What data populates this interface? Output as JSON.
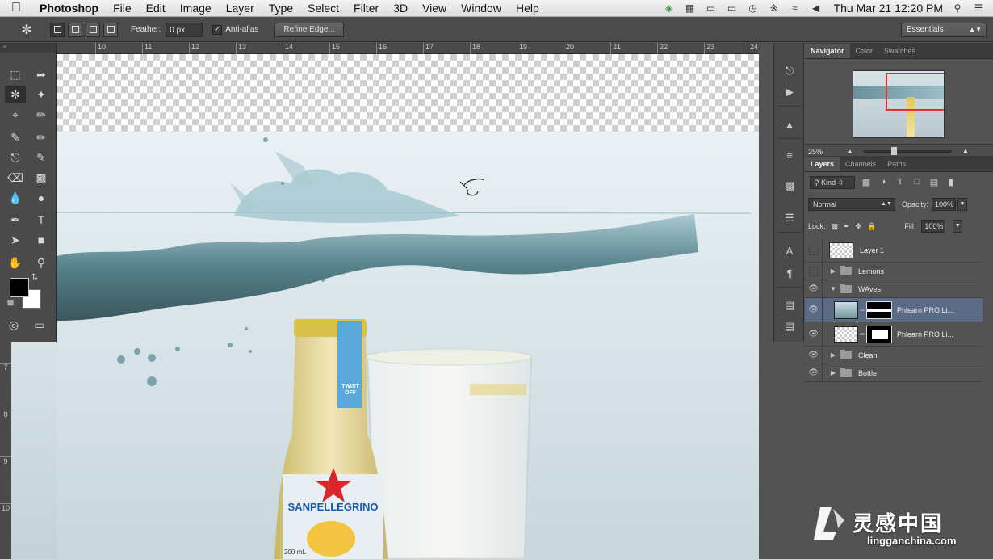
{
  "menubar": {
    "app_name": "Photoshop",
    "items": [
      "File",
      "Edit",
      "Image",
      "Layer",
      "Type",
      "Select",
      "Filter",
      "3D",
      "View",
      "Window",
      "Help"
    ],
    "clock": "Thu Mar 21  12:20 PM"
  },
  "options": {
    "feather_label": "Feather:",
    "feather_value": "0 px",
    "antialias_label": "Anti-alias",
    "refine_label": "Refine Edge...",
    "workspace": "Essentials"
  },
  "ruler": {
    "top": [
      "10",
      "11",
      "12",
      "13",
      "14",
      "15",
      "16",
      "17",
      "18",
      "19",
      "20",
      "21",
      "22",
      "23",
      "24"
    ],
    "left": [
      "7",
      "8",
      "9",
      "10"
    ]
  },
  "navigator": {
    "tabs": [
      "Navigator",
      "Color",
      "Swatches"
    ],
    "zoom": "25%"
  },
  "layers": {
    "tabs": [
      "Layers",
      "Channels",
      "Paths"
    ],
    "kind": "Kind",
    "blend_mode": "Normal",
    "opacity_label": "Opacity:",
    "opacity": "100%",
    "lock_label": "Lock:",
    "fill_label": "Fill:",
    "fill": "100%",
    "items": [
      {
        "name": "Layer 1"
      },
      {
        "name": "Lemons"
      },
      {
        "name": "WAves"
      },
      {
        "name": "Phlearn PRO Li..."
      },
      {
        "name": "Phlearn PRO Li..."
      },
      {
        "name": "Clean"
      },
      {
        "name": "Bottle"
      }
    ]
  },
  "canvas": {
    "bottle_cap_text": "TWIST OFF",
    "bottle_brand": "SANPELLEGRINO",
    "bottle_volume": "200 mL"
  },
  "watermark": {
    "chinese": "灵感中国",
    "latin": "lingganchina.com"
  },
  "colors": {
    "accent_selected_layer": "#5b6b85",
    "navigator_view_box": "#e03030",
    "foreground_color": "#000000",
    "background_color": "#ffffff"
  }
}
